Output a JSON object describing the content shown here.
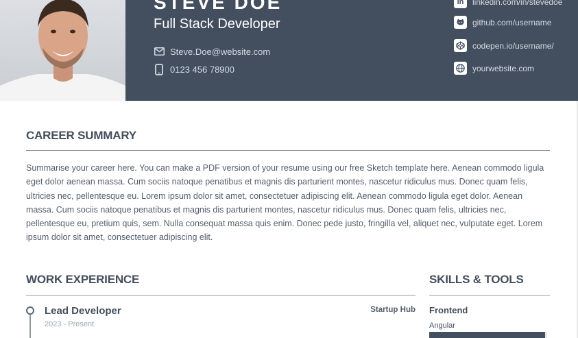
{
  "header": {
    "name": "STEVE DOE",
    "title": "Full Stack Developer",
    "email": "Steve.Doe@website.com",
    "phone": "0123 456 78900",
    "social": [
      {
        "label": "linkedin.com/in/stevedoe",
        "icon": "linkedin-icon"
      },
      {
        "label": "github.com/username",
        "icon": "github-icon"
      },
      {
        "label": "codepen.io/username/",
        "icon": "codepen-icon"
      },
      {
        "label": "yourwebsite.com",
        "icon": "globe-icon"
      }
    ]
  },
  "summary": {
    "heading": "CAREER SUMMARY",
    "text": "Summarise your career here. You can make a PDF version of your resume using our free Sketch template here. Aenean commodo ligula eget dolor aenean massa. Cum sociis natoque penatibus et magnis dis parturient montes, nascetur ridiculus mus. Donec quam felis, ultricies nec, pellentesque eu. Lorem ipsum dolor sit amet, consectetuer adipiscing elit. Aenean commodo ligula eget dolor. Aenean massa. Cum sociis natoque penatibus et magnis dis parturient montes, nascetur ridiculus mus. Donec quam felis, ultricies nec, pellentesque eu, pretium quis, sem. Nulla consequat massa quis enim. Donec pede justo, fringilla vel, aliquet nec, vulputate eget. Lorem ipsum dolor sit amet, consectetuer adipiscing elit."
  },
  "experience": {
    "heading": "WORK EXPERIENCE",
    "jobs": [
      {
        "title": "Lead Developer",
        "dates": "2023 - Present",
        "company": "Startup Hub"
      }
    ]
  },
  "skills": {
    "heading": "SKILLS & TOOLS",
    "categories": [
      {
        "name": "Frontend",
        "items": [
          {
            "name": "Angular",
            "level": 0.98
          }
        ]
      }
    ]
  },
  "colors": {
    "header_bg": "#434e5e",
    "accent": "#434e5e",
    "rule": "#8a98a8"
  }
}
